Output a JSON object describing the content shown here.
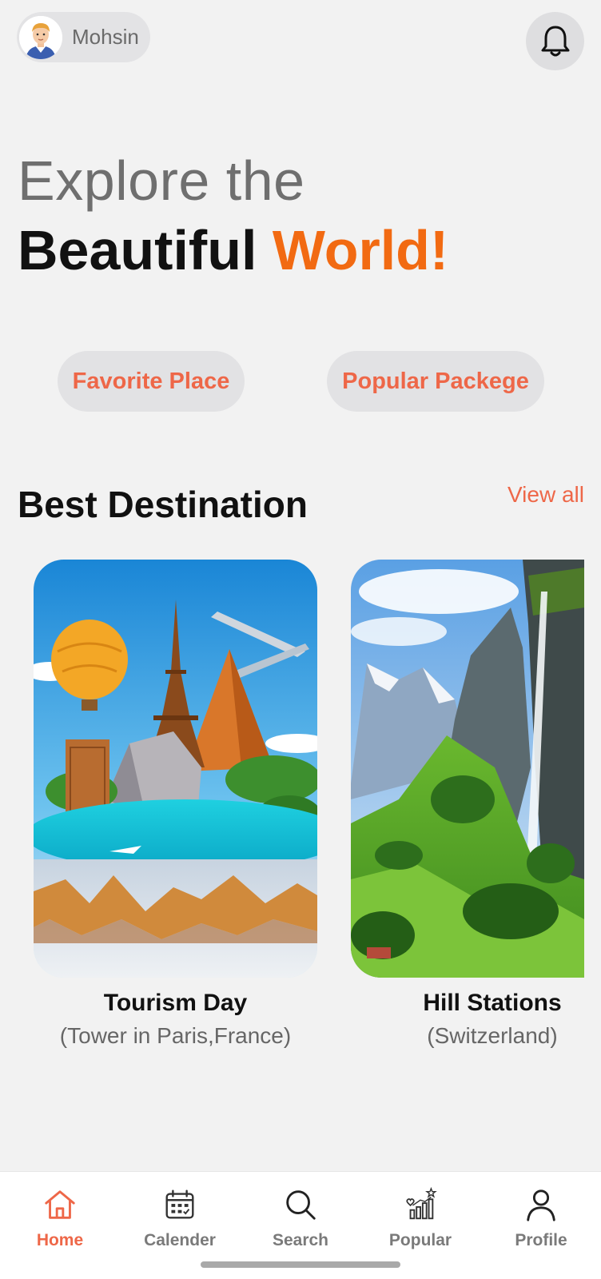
{
  "header": {
    "username": "Mohsin"
  },
  "hero": {
    "line1": "Explore the",
    "line2_main": "Beautiful ",
    "line2_accent": "World!"
  },
  "chips": [
    {
      "label": "Favorite Place"
    },
    {
      "label": "Popular Packege"
    }
  ],
  "section": {
    "title": "Best Destination",
    "view_all": "View all"
  },
  "destinations": [
    {
      "title": "Tourism Day",
      "subtitle": "(Tower in Paris,France)"
    },
    {
      "title": "Hill Stations",
      "subtitle": "(Switzerland)"
    }
  ],
  "nav": {
    "items": [
      {
        "label": "Home",
        "icon": "home-icon",
        "active": true
      },
      {
        "label": "Calender",
        "icon": "calendar-icon",
        "active": false
      },
      {
        "label": "Search",
        "icon": "search-icon",
        "active": false
      },
      {
        "label": "Popular",
        "icon": "popular-icon",
        "active": false
      },
      {
        "label": "Profile",
        "icon": "profile-icon",
        "active": false
      }
    ]
  },
  "colors": {
    "accent": "#f26a12",
    "chip_text": "#ee6748",
    "background": "#f2f2f2"
  }
}
